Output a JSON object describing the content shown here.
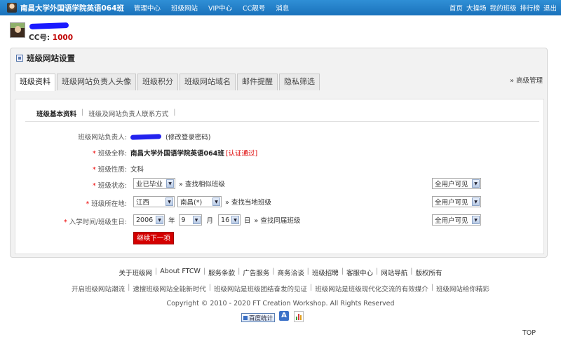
{
  "topbar": {
    "site_title": "南昌大学外国语学院英语064班",
    "nav": [
      "管理中心",
      "班级网站",
      "VIP中心",
      "CC靓号",
      "消息"
    ],
    "right_links": [
      "首页",
      "大操场",
      "我的班级",
      "排行榜",
      "退出"
    ]
  },
  "user": {
    "cc_label": "CC号:",
    "cc_number": "1000"
  },
  "panel": {
    "title": "班级网站设置",
    "tabs": [
      "班级资料",
      "班级网站负责人头像",
      "班级积分",
      "班级网站域名",
      "邮件提醒",
      "隐私筛选"
    ],
    "active_tab": "班级资料",
    "advanced_link": "» 高级管理",
    "subnav": [
      "班级基本资料",
      "班级及网站负责人联系方式"
    ]
  },
  "form": {
    "owner_label": "班级网站负责人:",
    "owner_link": "(修改登录密码)",
    "fullname_label": "班级全称:",
    "fullname_value": "南昌大学外国语学院英语064班",
    "verified": "[认证通过]",
    "nature_label": "班级性质:",
    "nature_value": "文科",
    "status_label": "班级状态:",
    "status_value": "业已毕业",
    "status_link": "» 查找相似班级",
    "location_label": "班级所在地:",
    "province_value": "江西",
    "city_value": "南昌(*)",
    "location_link": "» 查找当地班级",
    "date_label": "入学时间/班级生日:",
    "year_value": "2006",
    "year_unit": "年",
    "month_value": "9",
    "month_unit": "月",
    "day_value": "16",
    "day_unit": "日",
    "date_link": "» 查找同届班级",
    "visibility_value": "全用户可见",
    "next_button": "继续下一项"
  },
  "footer": {
    "links": [
      "关于班级网",
      "About FTCW",
      "服务条款",
      "广告服务",
      "商务洽谈",
      "班级招聘",
      "客服中心",
      "网站导航",
      "版权所有"
    ],
    "slogans": [
      "开启班级网站潮流",
      "速搜班级网站全能新时代",
      "班级网站是班级团结奋发的见证",
      "班级网站是班级现代化交流的有效媒介",
      "班级网站给你精彩"
    ],
    "copyright": "Copyright © 2010 - 2020 FT Creation Workshop. All Rights Reserved",
    "baidu_label": "百度统计",
    "a_icon": "A",
    "top_link": "TOP"
  }
}
